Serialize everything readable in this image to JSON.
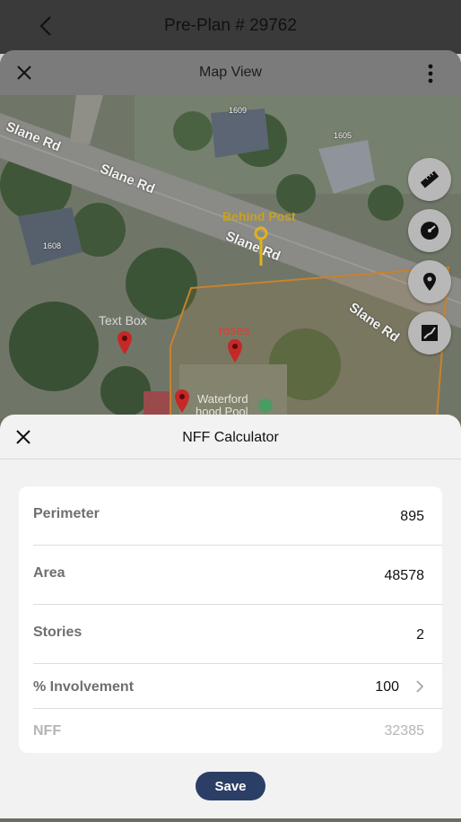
{
  "app_bar": {
    "title": "Pre-Plan # 29762"
  },
  "map_view": {
    "title": "Map View",
    "road_labels": [
      "Slane Rd",
      "Slane Rd",
      "Slane Rd",
      "Slane Rd"
    ],
    "house_numbers": [
      "1609",
      "1605",
      "1608"
    ],
    "markers": [
      {
        "label": "Behind Post",
        "color": "#d4a017"
      },
      {
        "label": "Text Box",
        "color": "#c62828"
      },
      {
        "label": "roses",
        "color": "#c62828"
      }
    ],
    "poi_text": [
      "Waterford",
      "hood Pool"
    ],
    "tools": [
      "ruler-icon",
      "gauge-icon",
      "pin-icon",
      "area-icon"
    ]
  },
  "nff_calculator": {
    "title": "NFF Calculator",
    "rows": [
      {
        "label": "Perimeter",
        "value": "895"
      },
      {
        "label": "Area",
        "value": "48578"
      },
      {
        "label": "Stories",
        "value": "2"
      },
      {
        "label": "% Involvement",
        "value": "100"
      },
      {
        "label": "NFF",
        "value": "32385"
      }
    ],
    "save_label": "Save"
  },
  "colors": {
    "save_button": "#2b3e66",
    "area_outline": "#c8822c",
    "sheet_background": "#f2f2f2"
  }
}
